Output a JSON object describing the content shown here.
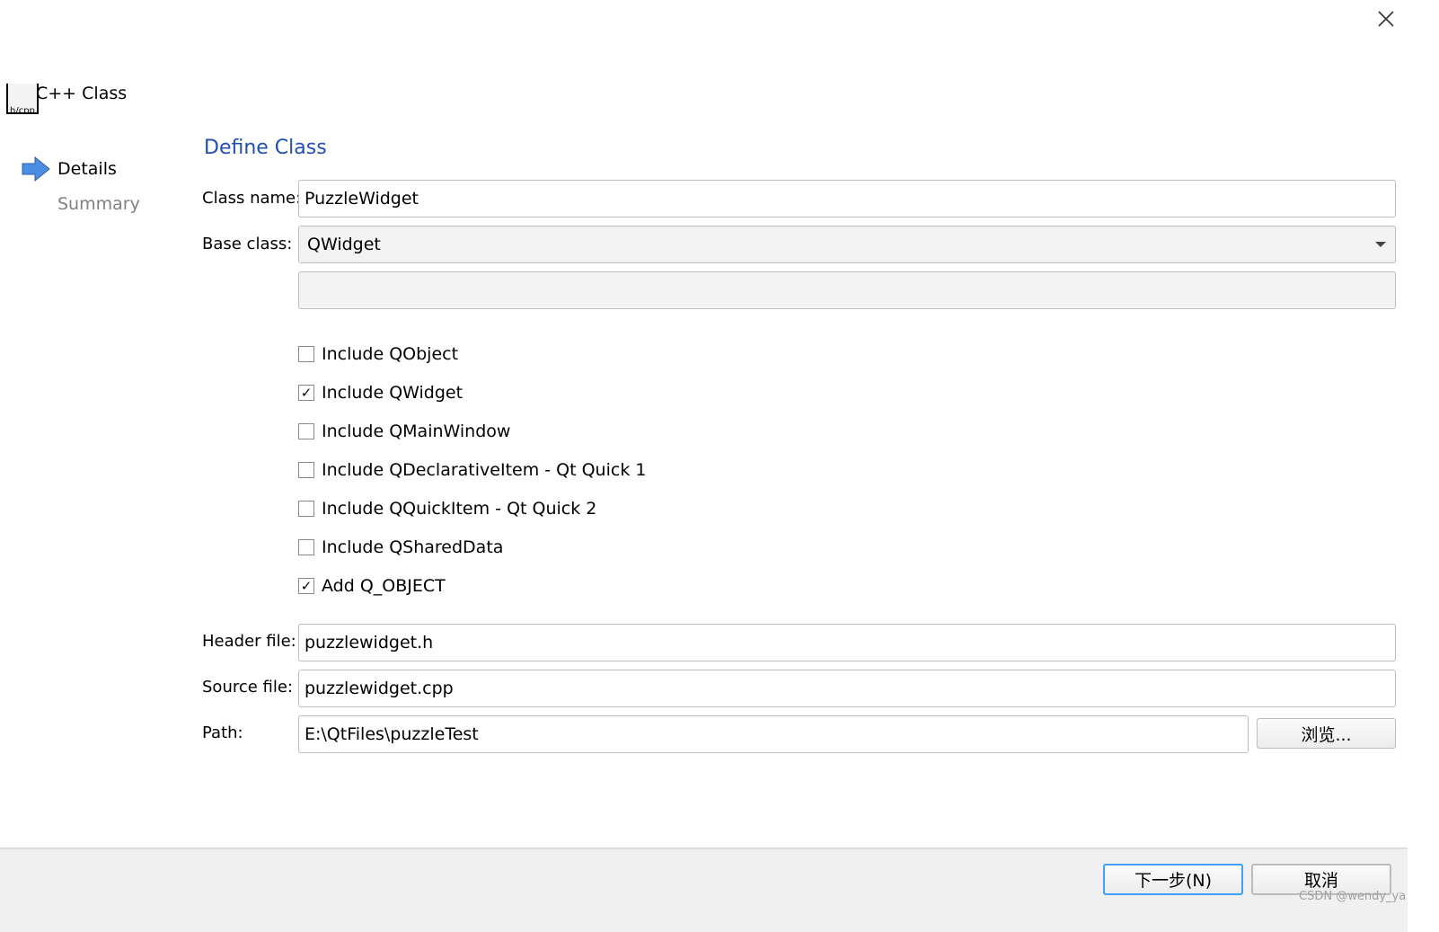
{
  "window": {
    "close_icon": "close-icon"
  },
  "wizard": {
    "title": "C++ Class",
    "icon_text": "h/cpp",
    "steps": [
      {
        "label": "Details",
        "active": true
      },
      {
        "label": "Summary",
        "active": false
      }
    ]
  },
  "page": {
    "title": "Define Class"
  },
  "form": {
    "class_name_label": "Class name:",
    "class_name": "PuzzleWidget",
    "base_class_label": "Base class:",
    "base_class": "QWidget",
    "extra_field": "",
    "checkboxes": [
      {
        "label": "Include QObject",
        "checked": false
      },
      {
        "label": "Include QWidget",
        "checked": true
      },
      {
        "label": "Include QMainWindow",
        "checked": false
      },
      {
        "label": "Include QDeclarativeItem - Qt Quick 1",
        "checked": false
      },
      {
        "label": "Include QQuickItem - Qt Quick 2",
        "checked": false
      },
      {
        "label": "Include QSharedData",
        "checked": false
      },
      {
        "label": "Add Q_OBJECT",
        "checked": true
      }
    ],
    "header_label": "Header file:",
    "header": "puzzlewidget.h",
    "source_label": "Source file:",
    "source": "puzzlewidget.cpp",
    "path_label": "Path:",
    "path": "E:\\QtFiles\\puzzleTest",
    "browse": "浏览..."
  },
  "footer": {
    "next": "下一步(N)",
    "cancel": "取消"
  },
  "watermark": "CSDN @wendy_ya",
  "colors": {
    "title": "#1f4fb4",
    "focus": "#3ea0ff"
  }
}
